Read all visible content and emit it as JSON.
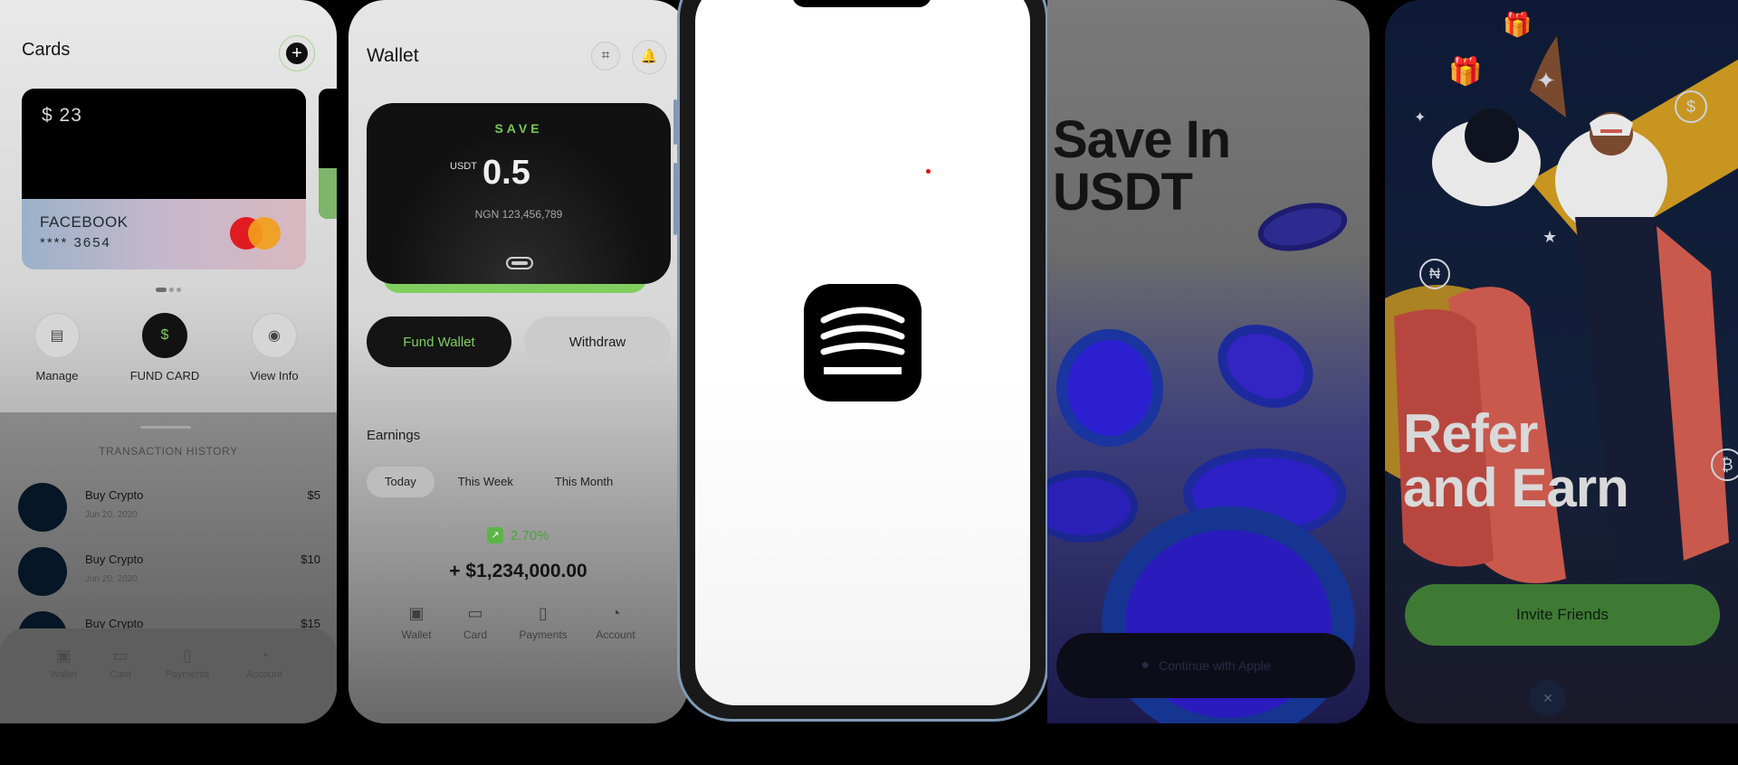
{
  "cards_screen": {
    "title": "Cards",
    "add_icon": "plus-circle-icon",
    "card": {
      "balance": "$ 23",
      "name": "FACEBOOK",
      "number": "**** 3654",
      "brand": "mastercard"
    },
    "actions": [
      {
        "label": "Manage",
        "icon": "card-stack-icon"
      },
      {
        "label": "FUND CARD",
        "icon": "dollar-plus-icon"
      },
      {
        "label": "View Info",
        "icon": "eye-icon"
      }
    ],
    "history_title": "TRANSACTION HISTORY",
    "transactions": [
      {
        "name": "Buy Crypto",
        "date": "Jun 20, 2020",
        "amount": "$5"
      },
      {
        "name": "Buy Crypto",
        "date": "Jun 20, 2020",
        "amount": "$10"
      },
      {
        "name": "Buy Crypto",
        "date": "",
        "amount": "$15"
      }
    ],
    "nav": [
      {
        "label": "Wallet",
        "icon": "wallet-icon"
      },
      {
        "label": "Card",
        "icon": "card-icon"
      },
      {
        "label": "Payments",
        "icon": "payments-icon"
      },
      {
        "label": "Account",
        "icon": "account-icon"
      }
    ]
  },
  "wallet_screen": {
    "title": "Wallet",
    "scan_icon": "scan-icon",
    "bell_icon": "bell-icon",
    "card": {
      "label": "SAVE",
      "currency": "USDT",
      "amount": "0.5",
      "fiat": "NGN 123,456,789"
    },
    "fund_label": "Fund Wallet",
    "withdraw_label": "Withdraw",
    "earnings_title": "Earnings",
    "tabs": [
      "Today",
      "This Week",
      "This Month"
    ],
    "active_tab": "Today",
    "percent": "2.70%",
    "amount": "+ $1,234,000.00",
    "nav": [
      {
        "label": "Wallet",
        "icon": "wallet-icon"
      },
      {
        "label": "Card",
        "icon": "card-icon"
      },
      {
        "label": "Payments",
        "icon": "payments-icon"
      },
      {
        "label": "Account",
        "icon": "account-icon"
      }
    ]
  },
  "splash_screen": {
    "logo_icon": "app-logo-icon"
  },
  "save_screen": {
    "title_line1": "Save In",
    "title_line2": "USDT",
    "apple_label": "Continue with Apple",
    "apple_icon": "apple-icon"
  },
  "refer_screen": {
    "title_line1": "Refer",
    "title_line2": "and Earn",
    "button_label": "Invite Friends",
    "close_icon": "close-icon",
    "close_glyph": "✕"
  },
  "colors": {
    "accent_green": "#7fcf5e",
    "card_dark": "#111111",
    "coin_blue": "#2c1fd0",
    "refer_bg": "#0e1a35"
  }
}
